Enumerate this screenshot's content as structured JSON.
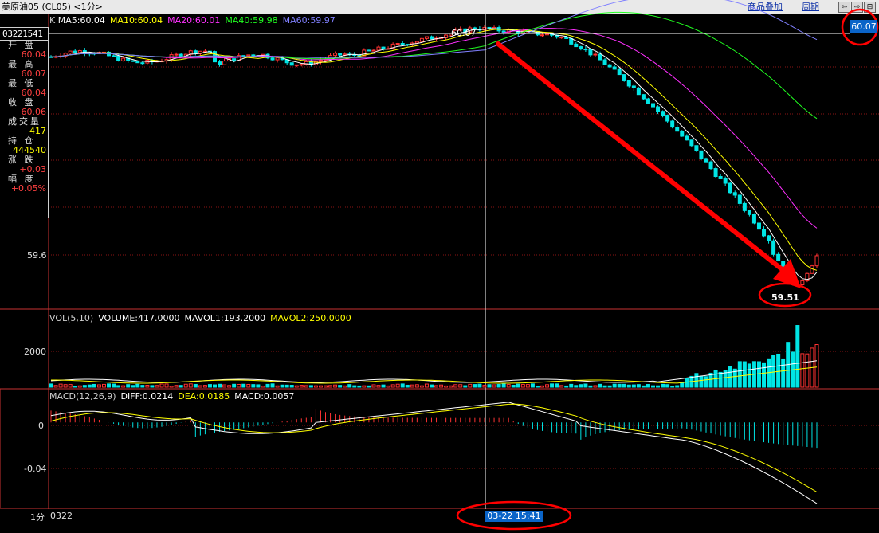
{
  "window": {
    "title": "美原油05 (CL05) <1分>",
    "links": [
      "商品叠加",
      "周期"
    ],
    "nav_buttons": [
      "⇦",
      "⇨",
      "⊟"
    ]
  },
  "quote_panel": {
    "code": "03221541",
    "rows": [
      {
        "label": "开 盘",
        "value": "60.04",
        "tone": "red"
      },
      {
        "label": "最 高",
        "value": "60.07",
        "tone": "red"
      },
      {
        "label": "最 低",
        "value": "60.04",
        "tone": "red"
      },
      {
        "label": "收 盘",
        "value": "60.06",
        "tone": "red"
      },
      {
        "label": "成交量",
        "value": "417",
        "tone": "yellow"
      },
      {
        "label": "持 仓",
        "value": "444540",
        "tone": "yellow"
      },
      {
        "label": "涨 跌",
        "value": "+0.03",
        "tone": "red"
      },
      {
        "label": "幅 度",
        "value": "+0.05%",
        "tone": "red"
      }
    ]
  },
  "kline_header": {
    "prefix": "K",
    "ma": [
      {
        "text": "MA5:60.04",
        "color": "#ffffff"
      },
      {
        "text": "MA10:60.04",
        "color": "#ffff00"
      },
      {
        "text": "MA20:60.01",
        "color": "#ff30ff"
      },
      {
        "text": "MA40:59.98",
        "color": "#20ff20"
      },
      {
        "text": "MA60:59.97",
        "color": "#8080ff"
      }
    ]
  },
  "vol_header": [
    {
      "text": "VOL(5,10)",
      "color": "#d0d0d0"
    },
    {
      "text": "VOLUME:417.0000",
      "color": "#ffffff"
    },
    {
      "text": "MAVOL1:193.2000",
      "color": "#ffffff"
    },
    {
      "text": "MAVOL2:250.0000",
      "color": "#ffff00"
    }
  ],
  "macd_header": [
    {
      "text": "MACD(12,26,9)",
      "color": "#d0d0d0"
    },
    {
      "text": "DIFF:0.0214",
      "color": "#ffffff"
    },
    {
      "text": "DEA:0.0185",
      "color": "#ffff00"
    },
    {
      "text": "MACD:0.0057",
      "color": "#ffffff"
    }
  ],
  "price_axis_label": "59.6",
  "vol_axis_label": "2000",
  "macd_axis_labels": [
    "0",
    "-0.04"
  ],
  "bottom": {
    "period": "1分",
    "date_label": "0322",
    "cursor_time": "03-22 15:41"
  },
  "cursor_price": "60.07",
  "annotations": {
    "high": "60.07",
    "low": "59.51"
  },
  "colors": {
    "up": "#ff3232",
    "down": "#00e5e5",
    "grid": "#8c1414",
    "arrow": "#ff0000"
  },
  "chart_data": {
    "type": "candlestick",
    "price_range": [
      59.49,
      60.09
    ],
    "high": 60.07,
    "low": 59.51,
    "macd_range": [
      -0.075,
      0.025
    ]
  }
}
